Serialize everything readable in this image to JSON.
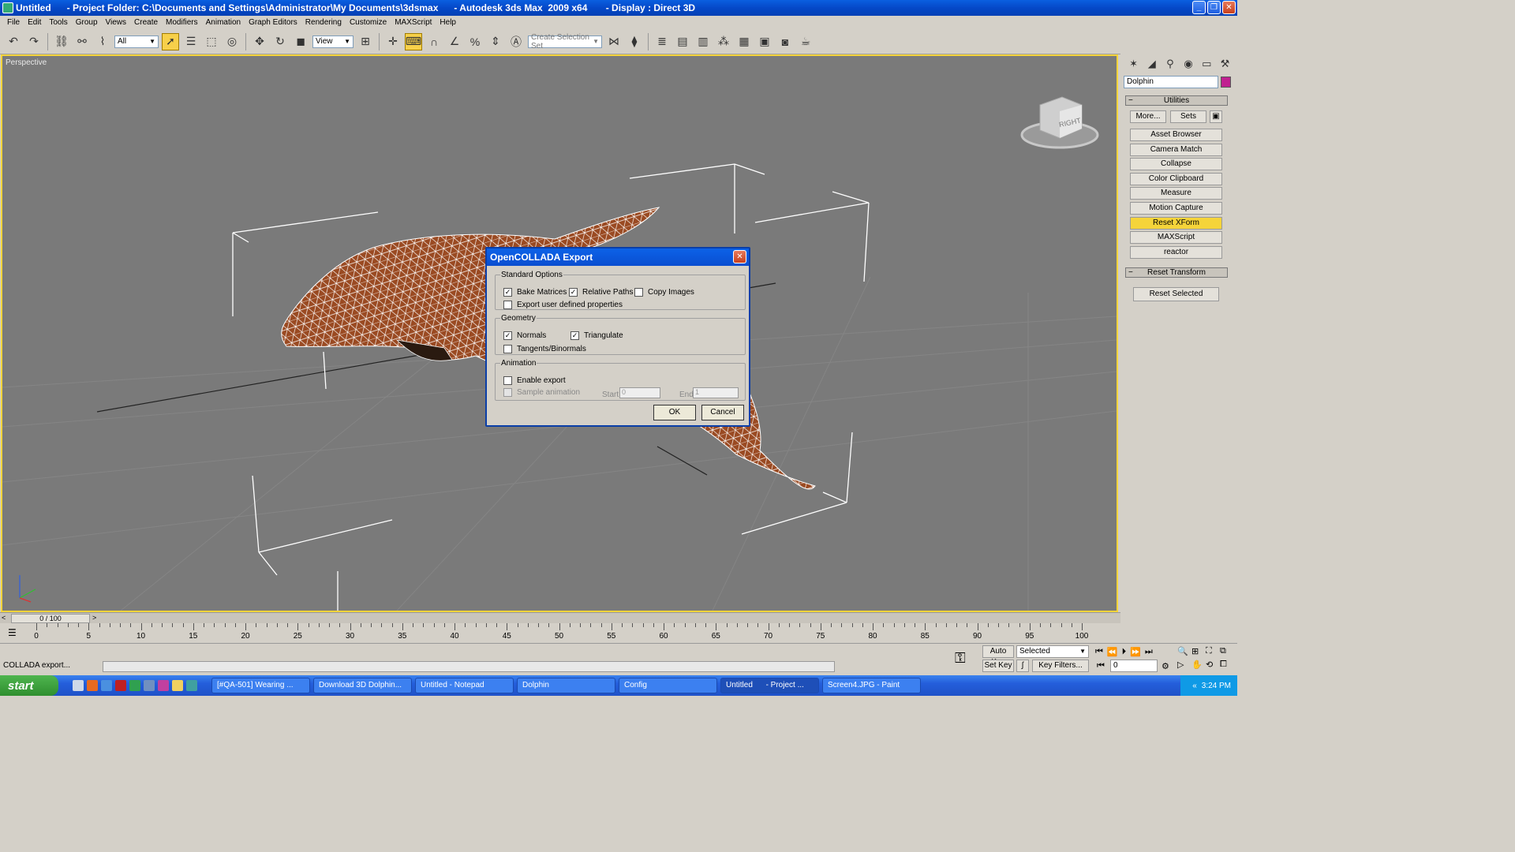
{
  "window": {
    "title": "Untitled      - Project Folder: C:\\Documents and Settings\\Administrator\\My Documents\\3dsmax      - Autodesk 3ds Max  2009 x64       - Display : Direct 3D"
  },
  "menu": [
    "File",
    "Edit",
    "Tools",
    "Group",
    "Views",
    "Create",
    "Modifiers",
    "Animation",
    "Graph Editors",
    "Rendering",
    "Customize",
    "MAXScript",
    "Help"
  ],
  "toolbar": {
    "filter": "All",
    "ref_coord": "View",
    "selection_set_placeholder": "Create Selection Set"
  },
  "viewport": {
    "label": "Perspective",
    "viewcube_label": "RIGHT"
  },
  "dialog": {
    "title": "OpenCOLLADA Export",
    "standard": {
      "legend": "Standard Options",
      "bake_matrices": "Bake Matrices",
      "relative_paths": "Relative Paths",
      "copy_images": "Copy Images",
      "export_user": "Export user defined properties"
    },
    "geometry": {
      "legend": "Geometry",
      "normals": "Normals",
      "triangulate": "Triangulate",
      "tangents": "Tangents/Binormals"
    },
    "animation": {
      "legend": "Animation",
      "enable_export": "Enable export",
      "sample": "Sample animation",
      "start_label": "Start:",
      "start_val": "0",
      "end_label": "End:",
      "end_val": "1"
    },
    "ok": "OK",
    "cancel": "Cancel",
    "check": "✓"
  },
  "command_panel": {
    "object_name": "Dolphin",
    "utilities_rollout": "Utilities",
    "more": "More...",
    "sets": "Sets",
    "utilities": [
      "Asset Browser",
      "Camera Match",
      "Collapse",
      "Color Clipboard",
      "Measure",
      "Motion Capture",
      "Reset XForm",
      "MAXScript",
      "reactor"
    ],
    "highlighted": "Reset XForm",
    "reset_transform_rollout": "Reset Transform",
    "reset_selected": "Reset Selected"
  },
  "timeline": {
    "frame_display": "0 / 100",
    "ticks": [
      "0",
      "5",
      "10",
      "15",
      "20",
      "25",
      "30",
      "35",
      "40",
      "45",
      "50",
      "55",
      "60",
      "65",
      "70",
      "75",
      "80",
      "85",
      "90",
      "95",
      "100"
    ]
  },
  "status": {
    "text": "COLLADA export...",
    "auto_key": "Auto Key",
    "set_key": "Set Key",
    "selected": "Selected",
    "key_filters": "Key Filters...",
    "frame": "0"
  },
  "taskbar": {
    "start": "start",
    "tasks": [
      "[#QA-501] Wearing ...",
      "Download 3D Dolphin...",
      "Untitled - Notepad",
      "Dolphin",
      "Config",
      "Untitled      - Project ...",
      "Screen4.JPG - Paint"
    ],
    "active_task": "Untitled      - Project ...",
    "clock": "3:24 PM"
  }
}
